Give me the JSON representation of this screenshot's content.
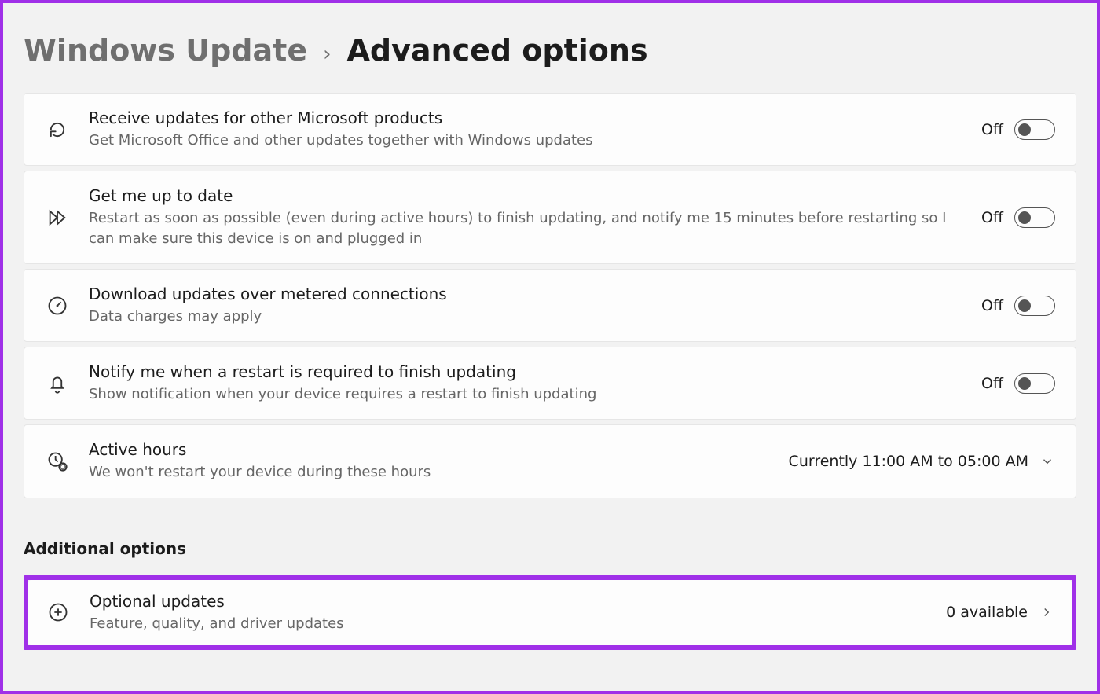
{
  "breadcrumb": {
    "parent": "Windows Update",
    "current": "Advanced options"
  },
  "settings": [
    {
      "title": "Receive updates for other Microsoft products",
      "desc": "Get Microsoft Office and other updates together with Windows updates",
      "state": "Off"
    },
    {
      "title": "Get me up to date",
      "desc": "Restart as soon as possible (even during active hours) to finish updating, and notify me 15 minutes before restarting so I can make sure this device is on and plugged in",
      "state": "Off"
    },
    {
      "title": "Download updates over metered connections",
      "desc": "Data charges may apply",
      "state": "Off"
    },
    {
      "title": "Notify me when a restart is required to finish updating",
      "desc": "Show notification when your device requires a restart to finish updating",
      "state": "Off"
    }
  ],
  "active_hours": {
    "title": "Active hours",
    "desc": "We won't restart your device during these hours",
    "value": "Currently 11:00 AM to 05:00 AM"
  },
  "section_title": "Additional options",
  "optional_updates": {
    "title": "Optional updates",
    "desc": "Feature, quality, and driver updates",
    "value": "0 available"
  }
}
